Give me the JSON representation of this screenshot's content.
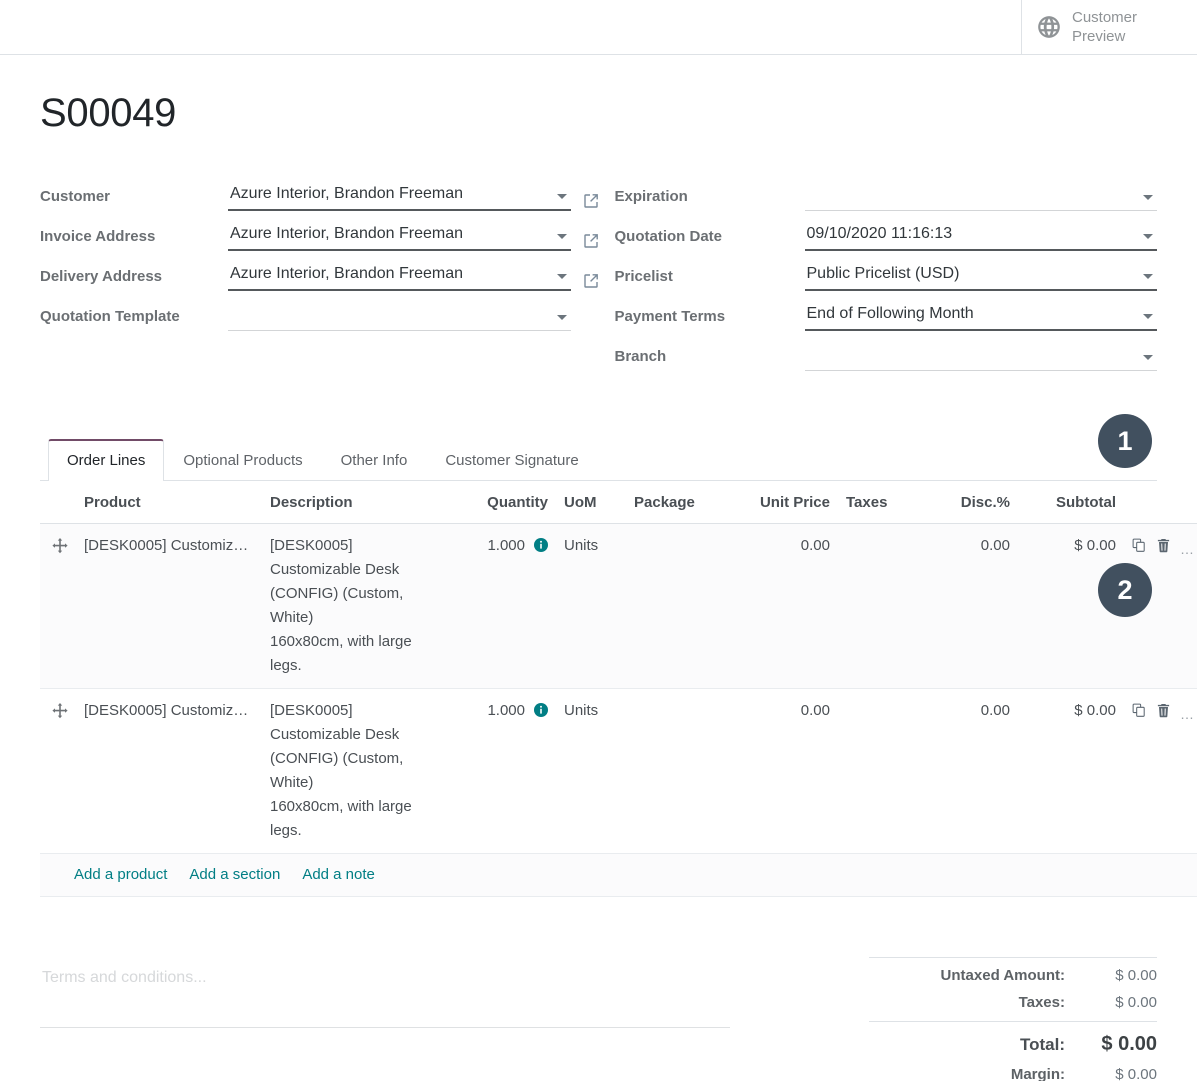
{
  "topbar": {
    "customer_preview_label": "Customer\nPreview",
    "globe_icon": "globe-icon"
  },
  "record": {
    "title": "S00049"
  },
  "form": {
    "left": [
      {
        "label": "Customer",
        "value": "Azure Interior, Brandon Freeman",
        "has_external_link": true,
        "empty": false
      },
      {
        "label": "Invoice Address",
        "value": "Azure Interior, Brandon Freeman",
        "has_external_link": true,
        "empty": false
      },
      {
        "label": "Delivery Address",
        "value": "Azure Interior, Brandon Freeman",
        "has_external_link": true,
        "empty": false
      },
      {
        "label": "Quotation Template",
        "value": "",
        "has_external_link": false,
        "empty": true
      }
    ],
    "right": [
      {
        "label": "Expiration",
        "value": "",
        "empty": true
      },
      {
        "label": "Quotation Date",
        "value": "09/10/2020 11:16:13",
        "empty": false
      },
      {
        "label": "Pricelist",
        "value": "Public Pricelist (USD)",
        "empty": false
      },
      {
        "label": "Payment Terms",
        "value": "End of Following Month",
        "empty": false
      },
      {
        "label": "Branch",
        "value": "",
        "empty": true
      }
    ]
  },
  "tabs": [
    {
      "label": "Order Lines",
      "active": true
    },
    {
      "label": "Optional Products",
      "active": false
    },
    {
      "label": "Other Info",
      "active": false
    },
    {
      "label": "Customer Signature",
      "active": false
    }
  ],
  "order_lines": {
    "columns": [
      "Product",
      "Description",
      "Quantity",
      "UoM",
      "Package",
      "Unit Price",
      "Taxes",
      "Disc.%",
      "Subtotal"
    ],
    "rows": [
      {
        "product": "[DESK0005] Customiz…",
        "description": "[DESK0005]\nCustomizable Desk\n(CONFIG) (Custom,\nWhite)\n160x80cm, with large\nlegs.",
        "quantity": "1.000",
        "uom": "Units",
        "package": "",
        "unit_price": "0.00",
        "taxes": "",
        "discount": "0.00",
        "subtotal": "$ 0.00",
        "row_dots": "…"
      },
      {
        "product": "[DESK0005] Customiz…",
        "description": "[DESK0005]\nCustomizable Desk\n(CONFIG) (Custom,\nWhite)\n160x80cm, with large\nlegs.",
        "quantity": "1.000",
        "uom": "Units",
        "package": "",
        "unit_price": "0.00",
        "taxes": "",
        "discount": "0.00",
        "subtotal": "$ 0.00",
        "row_dots": "…"
      }
    ],
    "add_links": [
      "Add a product",
      "Add a section",
      "Add a note"
    ]
  },
  "terms": {
    "placeholder": "Terms and conditions..."
  },
  "totals": [
    {
      "label": "Untaxed Amount:",
      "value": "$ 0.00",
      "grand": false
    },
    {
      "label": "Taxes:",
      "value": "$ 0.00",
      "grand": false
    },
    {
      "label": "Total:",
      "value": "$ 0.00",
      "grand": true
    },
    {
      "label": "Margin:",
      "value": "$ 0.00",
      "grand": false
    }
  ],
  "annotations": [
    {
      "number": "1"
    },
    {
      "number": "2"
    }
  ],
  "colors": {
    "accent_teal": "#017e84",
    "tab_active_border": "#714B67",
    "badge_bg": "#41505f",
    "label_gray": "#6b6f73"
  }
}
